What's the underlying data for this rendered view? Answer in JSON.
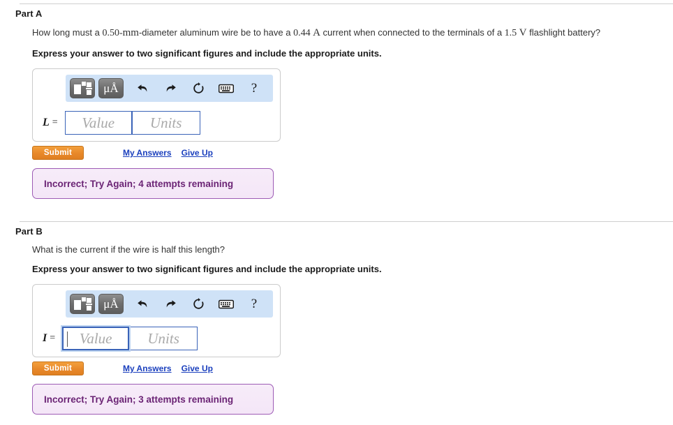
{
  "parts": [
    {
      "title": "Part A",
      "question_pre": "How long must a ",
      "question_num1": "0.50-",
      "question_unit1": "mm",
      "question_mid1": "-diameter aluminum wire be to have a ",
      "question_num2": "0.44 ",
      "question_unit2": "A",
      "question_mid2": " current when connected to the terminals of a ",
      "question_num3": "1.5 ",
      "question_unit3": "V",
      "question_post": " flashlight battery?",
      "instruction": "Express your answer to two significant figures and include the appropriate units.",
      "variable": "L",
      "equals": "=",
      "value_placeholder": "Value",
      "units_placeholder": "Units",
      "value_focused": false,
      "submit_label": "Submit",
      "my_answers_label": "My Answers",
      "give_up_label": "Give Up",
      "feedback": "Incorrect; Try Again; 4 attempts remaining"
    },
    {
      "title": "Part B",
      "question_plain": "What is the current if the wire is half this length?",
      "instruction": "Express your answer to two significant figures and include the appropriate units.",
      "variable": "I",
      "equals": "=",
      "value_placeholder": "Value",
      "units_placeholder": "Units",
      "value_focused": true,
      "submit_label": "Submit",
      "my_answers_label": "My Answers",
      "give_up_label": "Give Up",
      "feedback": "Incorrect; Try Again; 3 attempts remaining"
    }
  ],
  "toolbar": {
    "template_icon": "math-template-icon",
    "units_icon": "micro-angstrom-units-icon",
    "units_label": "μÅ",
    "undo_icon": "undo-icon",
    "redo_icon": "redo-icon",
    "reset_icon": "reset-icon",
    "keyboard_icon": "keyboard-icon",
    "help_icon": "help-icon",
    "help_label": "?"
  },
  "colors": {
    "toolbar_bg": "#cfe2f7",
    "submit_orange": "#e8882a",
    "link_blue": "#1a3fbd",
    "feedback_border": "#9d5bb5",
    "feedback_text": "#6b2475",
    "field_border": "#3a63b8"
  }
}
